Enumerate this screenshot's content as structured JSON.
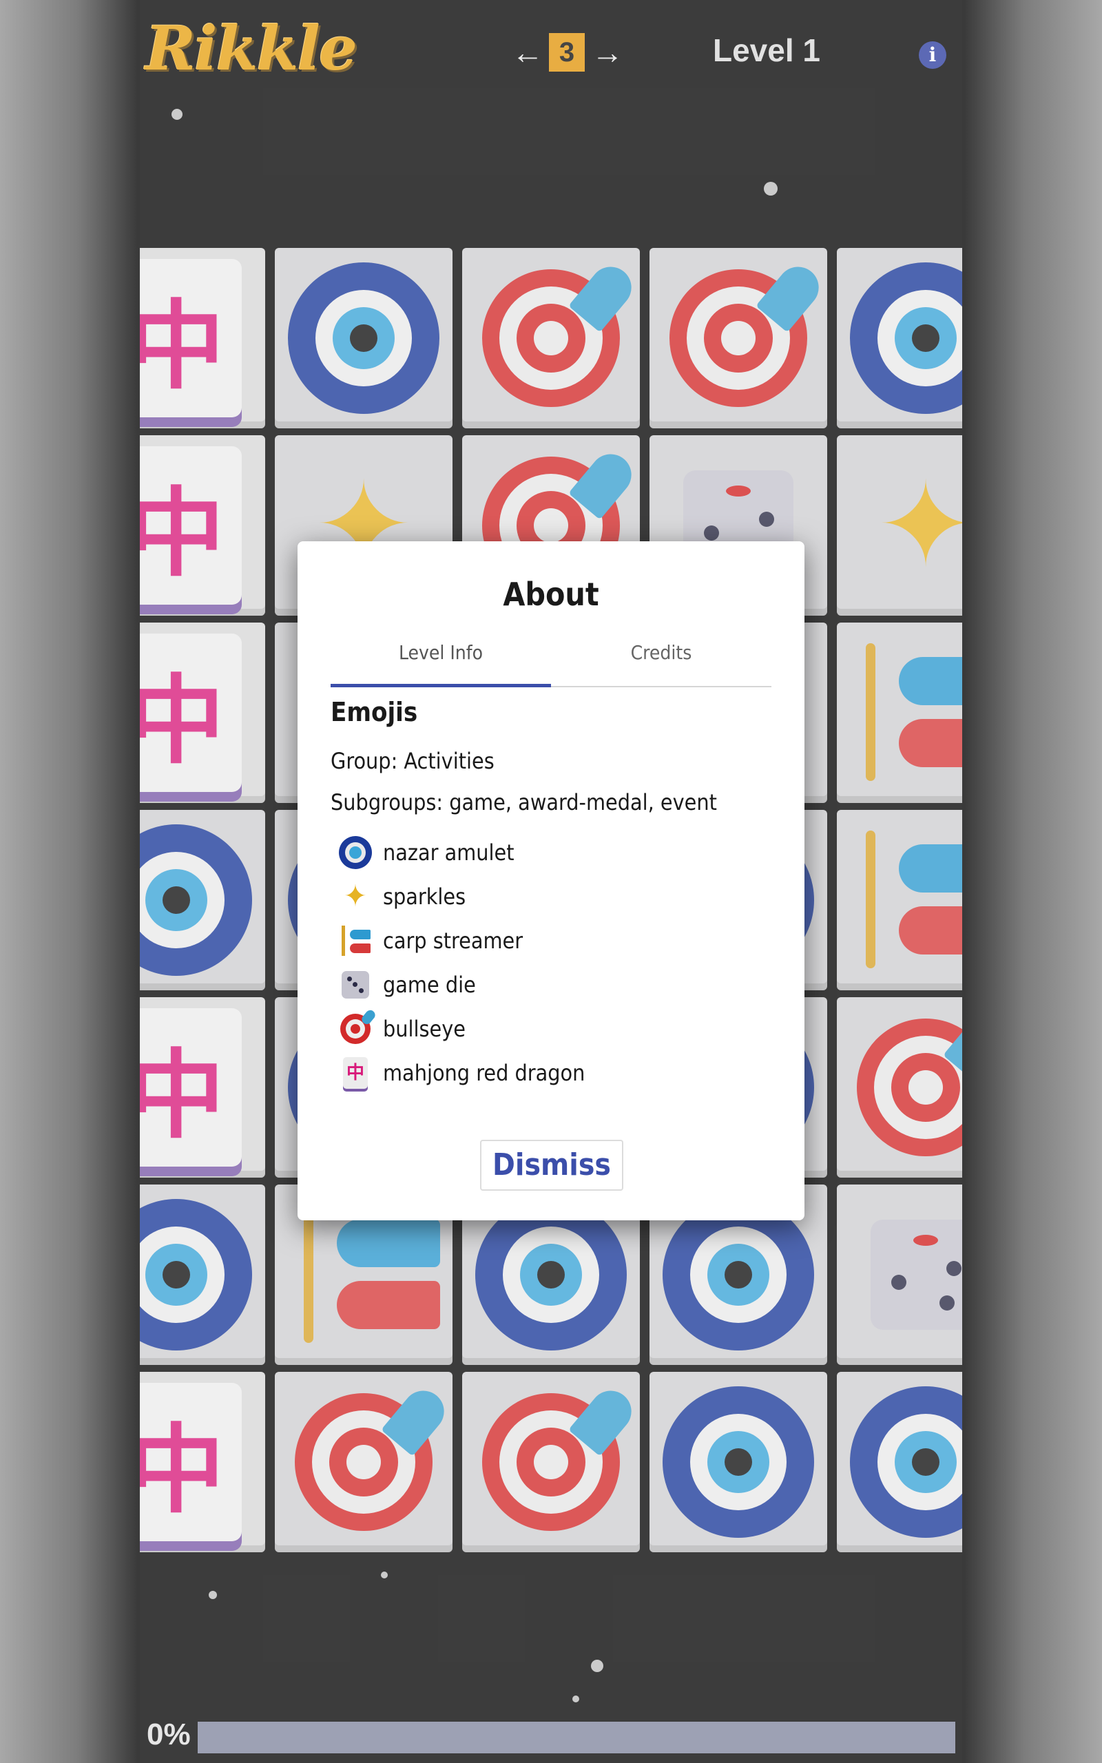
{
  "header": {
    "logo_text": "Rikkle",
    "prev_label": "←",
    "next_label": "→",
    "level_number": "3",
    "level_label": "Level 1",
    "info_label": "i"
  },
  "board": {
    "tile_names": [
      "mahjong red dragon",
      "nazar amulet",
      "bullseye",
      "game die",
      "sparkles",
      "carp streamer"
    ]
  },
  "modal": {
    "title": "About",
    "tabs": [
      {
        "label": "Level Info",
        "active": true
      },
      {
        "label": "Credits",
        "active": false
      }
    ],
    "heading": "Emojis",
    "group": "Group: Activities",
    "subgroups": "Subgroups: game, award-medal, event",
    "items": [
      {
        "icon": "nazar-amulet-icon",
        "label": "nazar amulet"
      },
      {
        "icon": "sparkles-icon",
        "label": "sparkles"
      },
      {
        "icon": "carp-streamer-icon",
        "label": "carp streamer"
      },
      {
        "icon": "game-die-icon",
        "label": "game die"
      },
      {
        "icon": "bullseye-icon",
        "label": "bullseye"
      },
      {
        "icon": "mahjong-red-dragon-icon",
        "label": "mahjong red dragon"
      }
    ],
    "dismiss_label": "Dismiss"
  },
  "progress": {
    "label": "0%",
    "fraction": 0
  },
  "colors": {
    "accent": "#3b4eaa",
    "level_badge": "#e2970d",
    "logo": "#e7a214"
  }
}
